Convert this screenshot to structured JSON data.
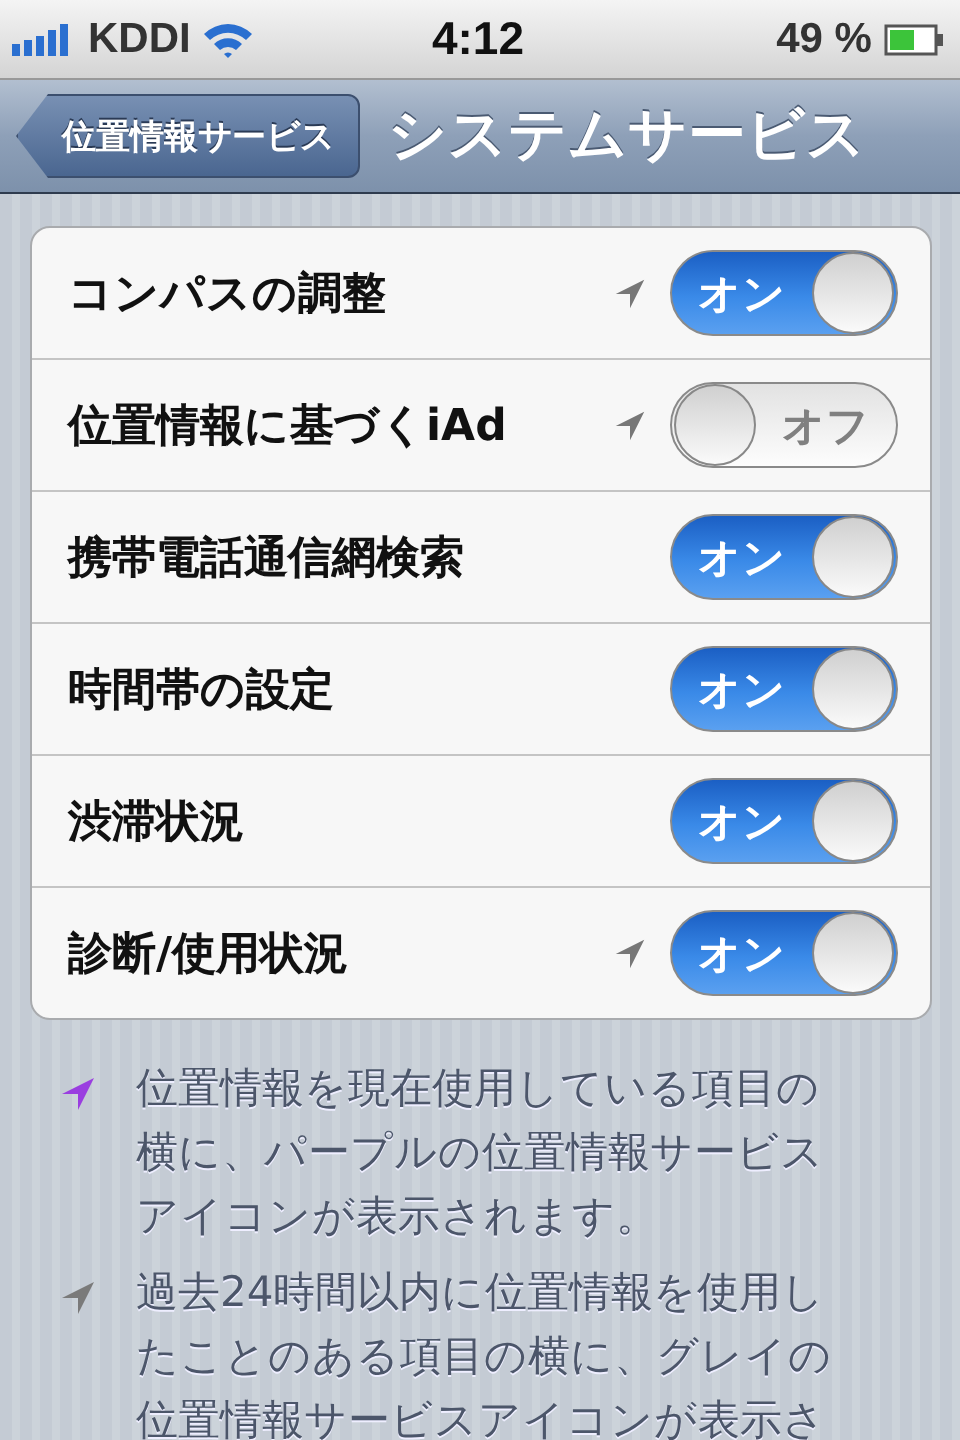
{
  "status_bar": {
    "carrier": "KDDI",
    "time": "4:12",
    "battery": "49 %"
  },
  "nav_bar": {
    "back": "位置情報サービス",
    "title": "システムサービス"
  },
  "rows": [
    {
      "label": "コンパスの調整",
      "location_icon": true,
      "on": true,
      "switch_label": "オン"
    },
    {
      "label": "位置情報に基づくiAd",
      "location_icon": true,
      "on": false,
      "switch_label": "オフ"
    },
    {
      "label": "携帯電話通信網検索",
      "location_icon": false,
      "on": true,
      "switch_label": "オン"
    },
    {
      "label": "時間帯の設定",
      "location_icon": false,
      "on": true,
      "switch_label": "オン"
    },
    {
      "label": "渋滞状況",
      "location_icon": false,
      "on": true,
      "switch_label": "オン"
    },
    {
      "label": "診断/使用状況",
      "location_icon": true,
      "on": true,
      "switch_label": "オン"
    }
  ],
  "notes": [
    {
      "color": "#9a3ee0",
      "text": "位置情報を現在使用している項目の横に、パープルの位置情報サービスアイコンが表示されます。"
    },
    {
      "color": "#7a7a7a",
      "text": "過去24時間以内に位置情報を使用したことのある項目の横に、グレイの位置情報サービスアイコンが表示さ"
    }
  ]
}
